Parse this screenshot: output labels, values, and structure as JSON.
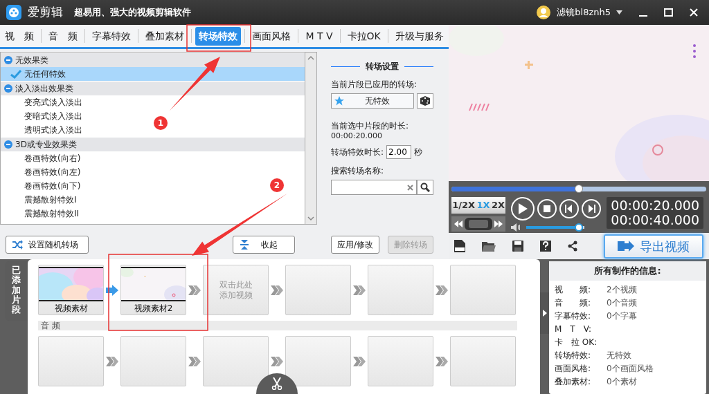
{
  "window": {
    "app_name": "爱剪辑",
    "subtitle": "超易用、强大的视频剪辑软件",
    "user": "滤镜bl8znh5"
  },
  "tabs": [
    {
      "label": "视　频",
      "selected": false
    },
    {
      "label": "音　频",
      "selected": false
    },
    {
      "label": "字幕特效",
      "selected": false
    },
    {
      "label": "叠加素材",
      "selected": false
    },
    {
      "label": "转场特效",
      "selected": true
    },
    {
      "label": "画面风格",
      "selected": false
    },
    {
      "label": "M T V",
      "selected": false
    },
    {
      "label": "卡拉OK",
      "selected": false
    },
    {
      "label": "升级与服务",
      "selected": false
    }
  ],
  "effect_tree": [
    {
      "label": "无效果类",
      "expanded": true,
      "children": [
        {
          "label": "无任何特效",
          "selected": true
        }
      ]
    },
    {
      "label": "淡入淡出效果类",
      "expanded": true,
      "children": [
        {
          "label": "变亮式淡入淡出",
          "selected": false
        },
        {
          "label": "变暗式淡入淡出",
          "selected": false
        },
        {
          "label": "透明式淡入淡出",
          "selected": false
        }
      ]
    },
    {
      "label": "3D或专业效果类",
      "expanded": true,
      "children": [
        {
          "label": "卷画特效(向右)",
          "selected": false
        },
        {
          "label": "卷画特效(向左)",
          "selected": false
        },
        {
          "label": "卷画特效(向下)",
          "selected": false
        },
        {
          "label": "震撼散射特效I",
          "selected": false
        },
        {
          "label": "震撼散射特效II",
          "selected": false
        }
      ]
    }
  ],
  "transition_settings": {
    "title": "转场设置",
    "applied_label": "当前片段已应用的转场:",
    "applied_value": "无特效",
    "duration_label": "当前选中片段的时长:",
    "duration_value": "00:00:20.000",
    "effect_duration_label": "转场特效时长:",
    "effect_duration_value": "2.00",
    "effect_duration_unit": "秒",
    "search_label": "搜索转场名称:",
    "apply_button": "应用/修改",
    "delete_button": {
      "label": "删除转场",
      "disabled": true
    }
  },
  "left_buttons": [
    "设置随机转场",
    "收起"
  ],
  "preview": {
    "kind": "picture"
  },
  "player": {
    "progress": {
      "level": 0.5
    },
    "speeds": [
      {
        "label": "1/2X",
        "selected": false
      },
      {
        "label": "1X",
        "selected": true
      },
      {
        "label": "2X",
        "selected": false
      }
    ],
    "volume": {
      "level": 0.97
    },
    "time_current": "00:00:20.000",
    "time_total": "00:00:40.000",
    "export_button": "导出视频"
  },
  "timeline": {
    "tab_label": "已添加片段",
    "audio_label": "音 频",
    "video_clips": [
      {
        "kind": "video",
        "label": "视频素材"
      },
      {
        "kind": "video",
        "label": "视频素材2"
      },
      {
        "kind": "add_prompt",
        "lines": [
          "双击此处",
          "添加视频"
        ]
      },
      {
        "kind": "empty"
      },
      {
        "kind": "empty"
      },
      {
        "kind": "empty"
      }
    ],
    "transitions": [
      {
        "applied": true
      },
      {
        "applied": false
      },
      {
        "applied": false
      },
      {
        "applied": false
      },
      {
        "applied": false
      }
    ],
    "audio_clips": [
      {
        "kind": "empty"
      },
      {
        "kind": "empty"
      },
      {
        "kind": "empty"
      },
      {
        "kind": "empty"
      },
      {
        "kind": "empty"
      },
      {
        "kind": "empty"
      }
    ]
  },
  "info": {
    "title": "所有制作的信息:",
    "rows": [
      {
        "label": "视　　频:",
        "value": "2个视频"
      },
      {
        "label": "音　　频:",
        "value": "0个音频"
      },
      {
        "label": "字幕特效:",
        "value": "0个字幕"
      },
      {
        "label": "M　T　V:"
      },
      {
        "label": "卡　拉 OK:"
      },
      {
        "label": "转场特效:",
        "value": "无特效"
      },
      {
        "label": "画面风格:",
        "value": "0个画面风格"
      },
      {
        "label": "叠加素材:",
        "value": "0个素材"
      }
    ]
  },
  "annotations": [
    {
      "kind": "box"
    },
    {
      "kind": "box"
    },
    {
      "kind": "arrow"
    },
    {
      "kind": "arrow"
    },
    {
      "kind": "marker",
      "label": "1"
    },
    {
      "kind": "marker",
      "label": "2"
    }
  ]
}
